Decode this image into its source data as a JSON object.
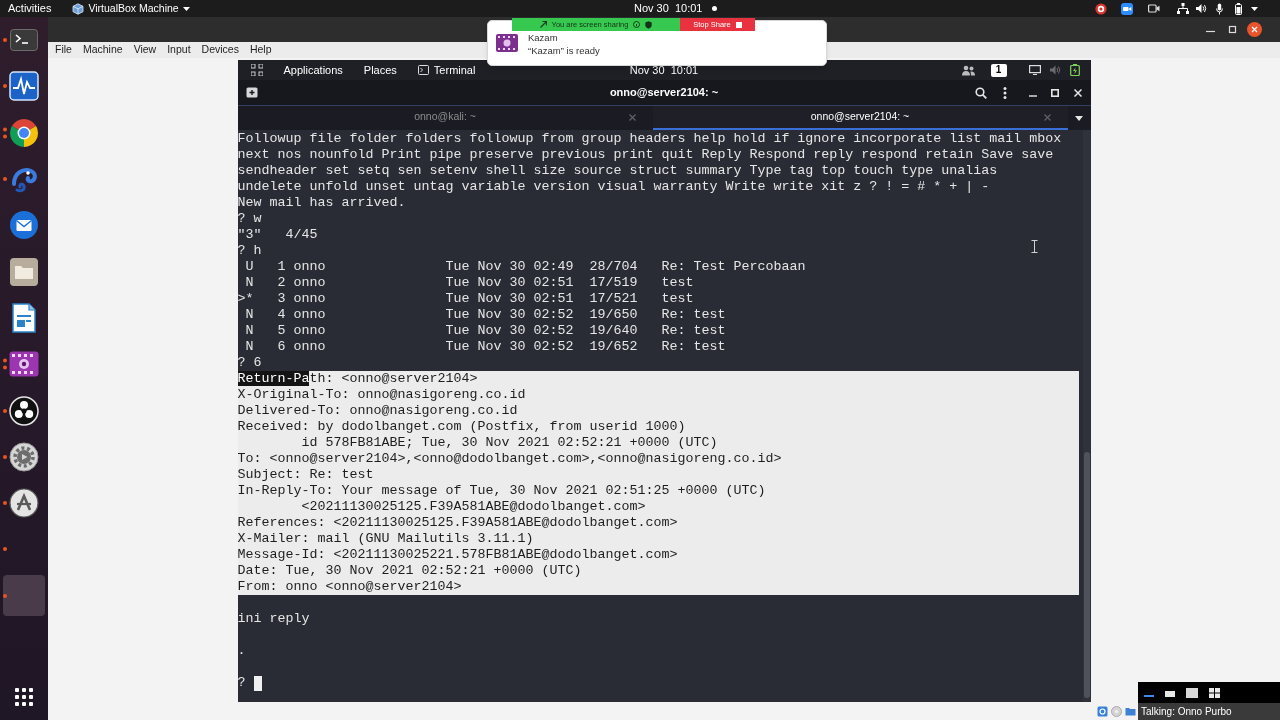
{
  "host_top_bar": {
    "activities": "Activities",
    "app_menu": "VirtualBox Machine",
    "clock": "Nov 30  10:01"
  },
  "screen_share": {
    "status": "You are screen sharing",
    "stop": "Stop Share"
  },
  "notification": {
    "app": "Kazam",
    "message": "“Kazam” is ready"
  },
  "dock": {
    "items": [
      {
        "kind": "terminal",
        "running": true,
        "multiple": false
      },
      {
        "kind": "monitor",
        "running": true,
        "multiple": false
      },
      {
        "kind": "browser",
        "running": true,
        "multiple": true
      },
      {
        "kind": "chameleon",
        "running": true,
        "multiple": false
      },
      {
        "kind": "mail",
        "running": false,
        "multiple": false
      },
      {
        "kind": "files",
        "running": false,
        "multiple": false
      },
      {
        "kind": "writer",
        "running": false,
        "multiple": false
      },
      {
        "kind": "video",
        "running": true,
        "multiple": true
      },
      {
        "kind": "obs",
        "running": true,
        "multiple": false
      },
      {
        "kind": "settings",
        "running": true,
        "multiple": false
      },
      {
        "kind": "software",
        "running": true,
        "multiple": false
      },
      {
        "kind": "blank",
        "running": true,
        "multiple": false
      },
      {
        "kind": "tile",
        "running": true,
        "multiple": false
      }
    ]
  },
  "vbox_menu": [
    "File",
    "Machine",
    "View",
    "Input",
    "Devices",
    "Help"
  ],
  "guest_panel": {
    "menus": [
      {
        "label": "Applications",
        "kind": "menu"
      },
      {
        "label": "Places",
        "kind": "menu"
      },
      {
        "label": "Terminal",
        "kind": "app"
      }
    ],
    "clock": "Nov 30  10:01",
    "workspace": "1"
  },
  "terminal": {
    "title": "onno@server2104: ~",
    "tabs": [
      {
        "label": "onno@kali: ~",
        "selected": false
      },
      {
        "label": "onno@server2104: ~",
        "selected": true
      }
    ],
    "help_lines": [
      "Followup file folder folders followup from group headers help hold if ignore incorporate list mail mbox",
      "next nos nounfold Print pipe preserve previous print quit Reply Respond reply respond retain Save save",
      "sendheader set setq sen setenv shell size source struct summary Type tag top touch type unalias",
      "undelete unfold unset untag variable version visual warranty Write write xit z ? ! = # * + | -"
    ],
    "session_lines": [
      "New mail has arrived.",
      "? w",
      "\"3\"   4/45",
      "? h"
    ],
    "messages": [
      {
        "flag": "U",
        "number": "1",
        "sender": "onno",
        "date": "Tue Nov 30 02:49",
        "size": "28/704",
        "subject": "Re: Test Percobaan"
      },
      {
        "flag": "N",
        "number": "2",
        "sender": "onno",
        "date": "Tue Nov 30 02:51",
        "size": "17/519",
        "subject": "test"
      },
      {
        "flag": ">*",
        "number": "3",
        "sender": "onno",
        "date": "Tue Nov 30 02:51",
        "size": "17/521",
        "subject": "test"
      },
      {
        "flag": "N",
        "number": "4",
        "sender": "onno",
        "date": "Tue Nov 30 02:52",
        "size": "19/650",
        "subject": "Re: test"
      },
      {
        "flag": "N",
        "number": "5",
        "sender": "onno",
        "date": "Tue Nov 30 02:52",
        "size": "19/640",
        "subject": "Re: test"
      },
      {
        "flag": "N",
        "number": "6",
        "sender": "onno",
        "date": "Tue Nov 30 02:52",
        "size": "19/652",
        "subject": "Re: test"
      }
    ],
    "command": "? 6",
    "headers": {
      "selected": true,
      "lines": [
        {
          "marked": "Return-Pa",
          "text": "th: <onno@server2104>"
        },
        {
          "text": "X-Original-To: onno@nasigoreng.co.id"
        },
        {
          "text": "Delivered-To: onno@nasigoreng.co.id"
        },
        {
          "text": "Received: by dodolbanget.com (Postfix, from userid 1000)"
        },
        {
          "text": "        id 578FB81ABE; Tue, 30 Nov 2021 02:52:21 +0000 (UTC)"
        },
        {
          "text": "To: <onno@server2104>,<onno@dodolbanget.com>,<onno@nasigoreng.co.id>"
        },
        {
          "text": "Subject: Re: test"
        },
        {
          "text": "In-Reply-To: Your message of Tue, 30 Nov 2021 02:51:25 +0000 (UTC)"
        },
        {
          "text": "        <20211130025125.F39A581ABE@dodolbanget.com>"
        },
        {
          "text": "References: <20211130025125.F39A581ABE@dodolbanget.com>"
        },
        {
          "text": "X-Mailer: mail (GNU Mailutils 3.11.1)"
        },
        {
          "text": "Message-Id: <20211130025221.578FB81ABE@dodolbanget.com>"
        },
        {
          "text": "Date: Tue, 30 Nov 2021 02:52:21 +0000 (UTC)"
        },
        {
          "text": "From: onno <onno@server2104>"
        }
      ]
    },
    "body": [
      "ini reply",
      "."
    ],
    "prompt": "?"
  },
  "talk_widget": {
    "status": "Talking: Onno Purbo"
  }
}
